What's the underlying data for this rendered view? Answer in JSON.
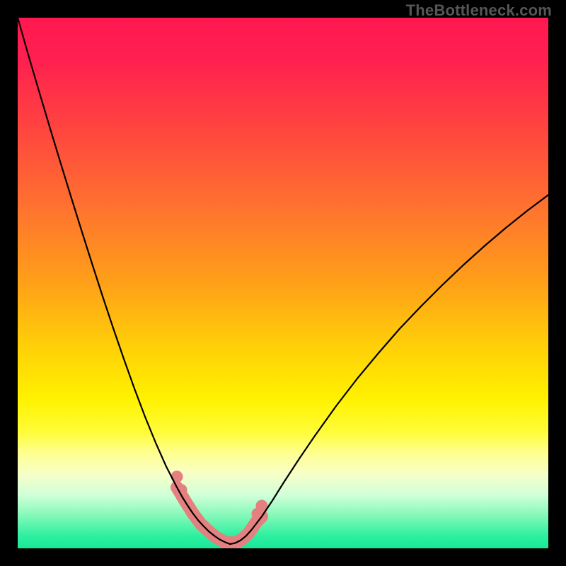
{
  "watermark": "TheBottleneck.com",
  "chart_data": {
    "type": "line",
    "title": "",
    "xlabel": "",
    "ylabel": "",
    "xlim": [
      0,
      100
    ],
    "ylim": [
      0,
      100
    ],
    "gradient_stops": [
      {
        "offset": 0.0,
        "color": "#ff1850"
      },
      {
        "offset": 0.08,
        "color": "#ff2050"
      },
      {
        "offset": 0.2,
        "color": "#ff4240"
      },
      {
        "offset": 0.35,
        "color": "#ff7030"
      },
      {
        "offset": 0.5,
        "color": "#ffa018"
      },
      {
        "offset": 0.62,
        "color": "#ffd008"
      },
      {
        "offset": 0.72,
        "color": "#fff200"
      },
      {
        "offset": 0.78,
        "color": "#fffc38"
      },
      {
        "offset": 0.82,
        "color": "#ffff90"
      },
      {
        "offset": 0.86,
        "color": "#f8ffc8"
      },
      {
        "offset": 0.9,
        "color": "#d0ffd8"
      },
      {
        "offset": 0.94,
        "color": "#80f8b8"
      },
      {
        "offset": 0.975,
        "color": "#30f0a0"
      },
      {
        "offset": 1.0,
        "color": "#18e898"
      }
    ],
    "series": [
      {
        "name": "bottleneck-curve-left",
        "stroke": "#000000",
        "width": 2.2,
        "x": [
          0.0,
          2.0,
          4.0,
          6.0,
          8.0,
          10.0,
          12.0,
          14.0,
          16.0,
          18.0,
          20.0,
          22.0,
          24.0,
          26.0,
          28.0,
          30.0,
          31.0,
          32.0,
          33.0,
          34.0,
          35.0,
          36.0,
          37.0,
          38.0,
          39.0,
          40.0
        ],
        "y": [
          100.0,
          93.0,
          86.2,
          79.5,
          72.9,
          66.4,
          60.0,
          53.7,
          47.5,
          41.5,
          35.7,
          30.1,
          24.8,
          19.9,
          15.4,
          11.5,
          9.7,
          8.1,
          6.6,
          5.3,
          4.2,
          3.2,
          2.4,
          1.7,
          1.2,
          0.8
        ]
      },
      {
        "name": "bottleneck-curve-right",
        "stroke": "#000000",
        "width": 2.2,
        "x": [
          40.0,
          41.0,
          42.0,
          43.0,
          44.0,
          46.0,
          48.0,
          50.0,
          53.0,
          56.0,
          60.0,
          64.0,
          68.0,
          72.0,
          76.0,
          80.0,
          84.0,
          88.0,
          92.0,
          96.0,
          100.0
        ],
        "y": [
          0.8,
          1.0,
          1.5,
          2.3,
          3.4,
          6.0,
          9.0,
          12.2,
          16.8,
          21.2,
          26.8,
          32.0,
          36.8,
          41.4,
          45.6,
          49.6,
          53.4,
          57.0,
          60.4,
          63.6,
          66.6
        ]
      },
      {
        "name": "highlight-band",
        "stroke": "#e58080",
        "width": 18,
        "x": [
          30.0,
          31.5,
          33.0,
          34.5,
          36.0,
          37.5,
          39.0,
          40.5,
          42.0,
          43.5,
          45.0,
          46.0
        ],
        "y": [
          11.5,
          9.0,
          6.6,
          4.6,
          3.2,
          2.0,
          1.2,
          1.0,
          1.5,
          2.8,
          5.0,
          6.0
        ]
      }
    ],
    "legend": [],
    "annotations": []
  }
}
